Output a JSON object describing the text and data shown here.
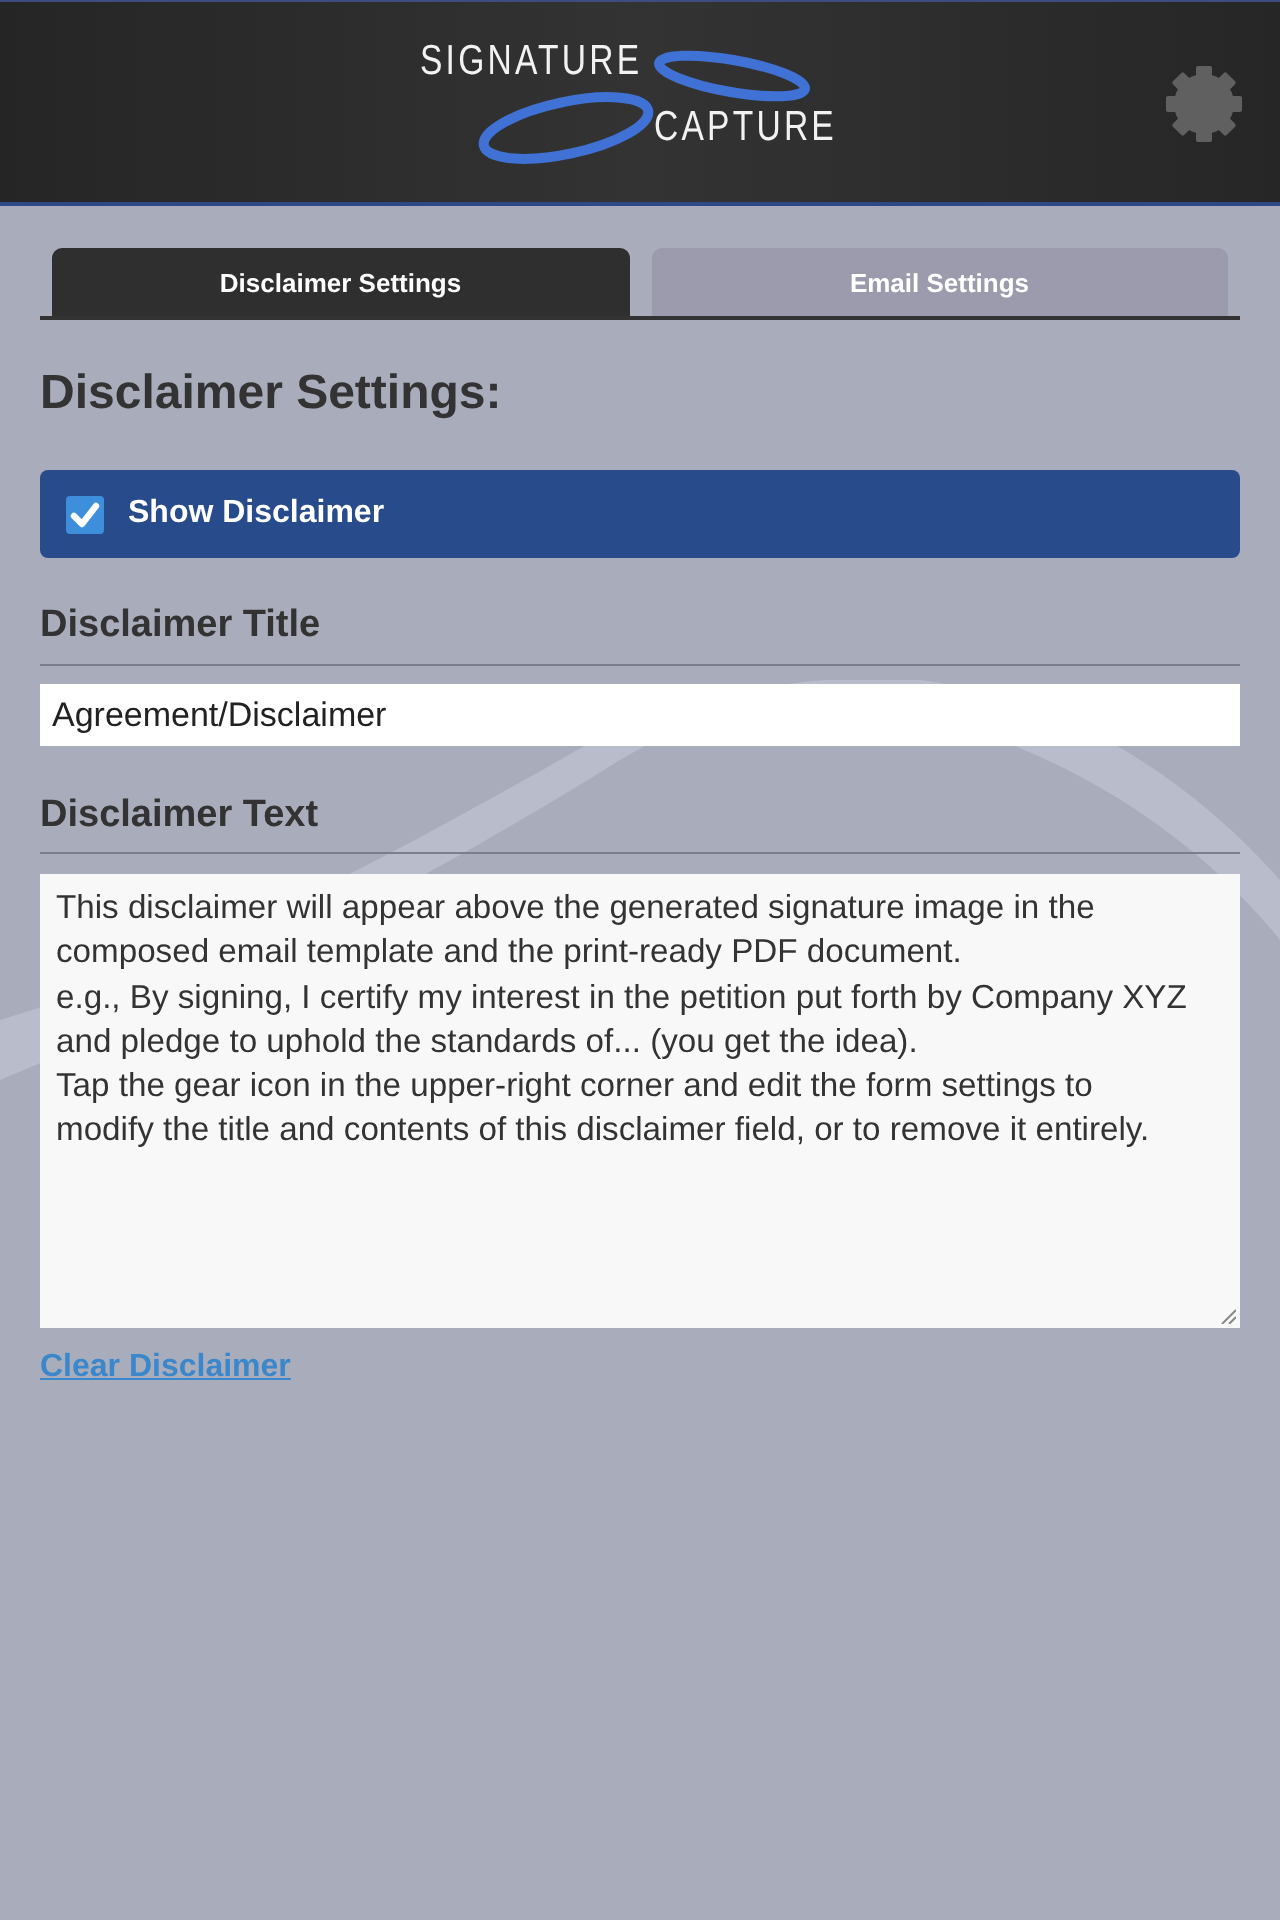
{
  "header": {
    "logo": {
      "line_1": "SIGNATURE",
      "line_2": "CAPTURE"
    }
  },
  "tabs": [
    {
      "label": "Disclaimer Settings",
      "selected": true
    },
    {
      "label": "Email Settings",
      "selected": false
    }
  ],
  "section_title": "Disclaimer Settings:",
  "show_disclaimer": {
    "label": "Show Disclaimer",
    "checked": true
  },
  "fields": [
    {
      "kind": "input",
      "label": "Disclaimer Title",
      "value": "Agreement/Disclaimer"
    },
    {
      "kind": "textarea",
      "label": "Disclaimer Text",
      "value": "This disclaimer will appear above the generated signature image in the composed email template and the print-ready PDF document.\ne.g., By signing, I certify my interest in the petition put forth by Company XYZ and pledge to uphold the standards of... (you get the idea).\nTap the gear icon in the upper-right corner and edit the form settings to modify the title and contents of this disclaimer field, or to remove it entirely."
    }
  ],
  "clear_link": "Clear Disclaimer"
}
